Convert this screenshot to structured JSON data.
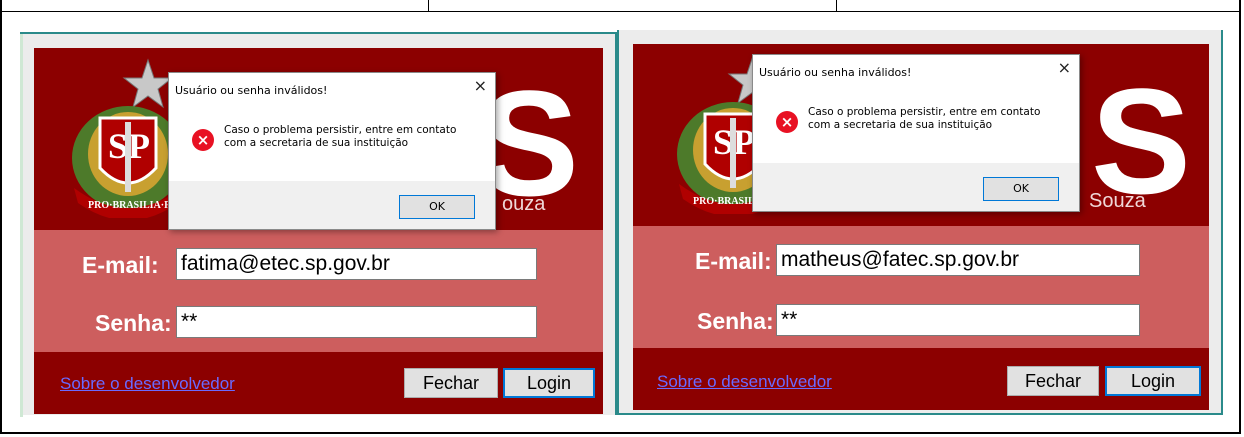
{
  "panels": [
    {
      "dialog": {
        "title": "Usuário ou senha inválidos!",
        "close_glyph": "×",
        "message_line1": "Caso o problema persistir, entre em contato",
        "message_line2": "com a secretaria de sua instituição",
        "ok_label": "OK",
        "icon": "error-icon"
      },
      "brand_letter": "S",
      "brand_tail": "ouza",
      "email_label": "E-mail:",
      "email_value": "fatima@etec.sp.gov.br",
      "password_label": "Senha:",
      "password_value": "**",
      "about_link": "Sobre o desenvolvedor",
      "close_button": "Fechar",
      "login_button": "Login"
    },
    {
      "dialog": {
        "title": "Usuário ou senha inválidos!",
        "close_glyph": "×",
        "message_line1": "Caso o problema persistir, entre em contato",
        "message_line2": "com a secretaria de sua instituição",
        "ok_label": "OK",
        "icon": "error-icon"
      },
      "brand_letter": "S",
      "brand_tail": "Souza",
      "email_label": "E-mail:",
      "email_value": "matheus@fatec.sp.gov.br",
      "password_label": "Senha:",
      "password_value": "**",
      "about_link": "Sobre o desenvolvedor",
      "close_button": "Fechar",
      "login_button": "Login"
    }
  ],
  "colors": {
    "dark_red": "#8c0000",
    "pink_band": "#cd5e5e",
    "link": "#6a6aff",
    "accent": "#0078d7",
    "error": "#e81123"
  }
}
